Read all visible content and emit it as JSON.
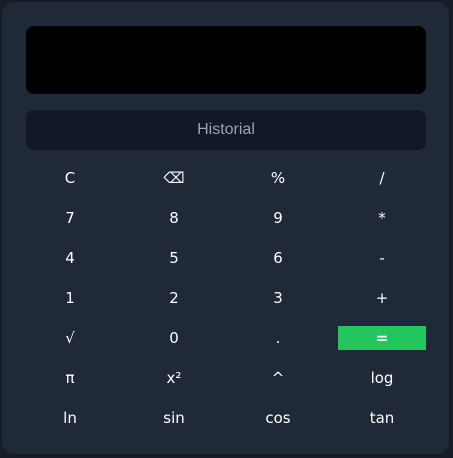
{
  "display": {
    "value": ""
  },
  "history": {
    "label": "Historial"
  },
  "accent_color": "#22c55e",
  "keys": [
    [
      "C",
      "⌫",
      "%",
      "/"
    ],
    [
      "7",
      "8",
      "9",
      "*"
    ],
    [
      "4",
      "5",
      "6",
      "-"
    ],
    [
      "1",
      "2",
      "3",
      "+"
    ],
    [
      "√",
      "0",
      ".",
      "="
    ],
    [
      "π",
      "x²",
      "^",
      "log"
    ],
    [
      "ln",
      "sin",
      "cos",
      "tan"
    ]
  ]
}
